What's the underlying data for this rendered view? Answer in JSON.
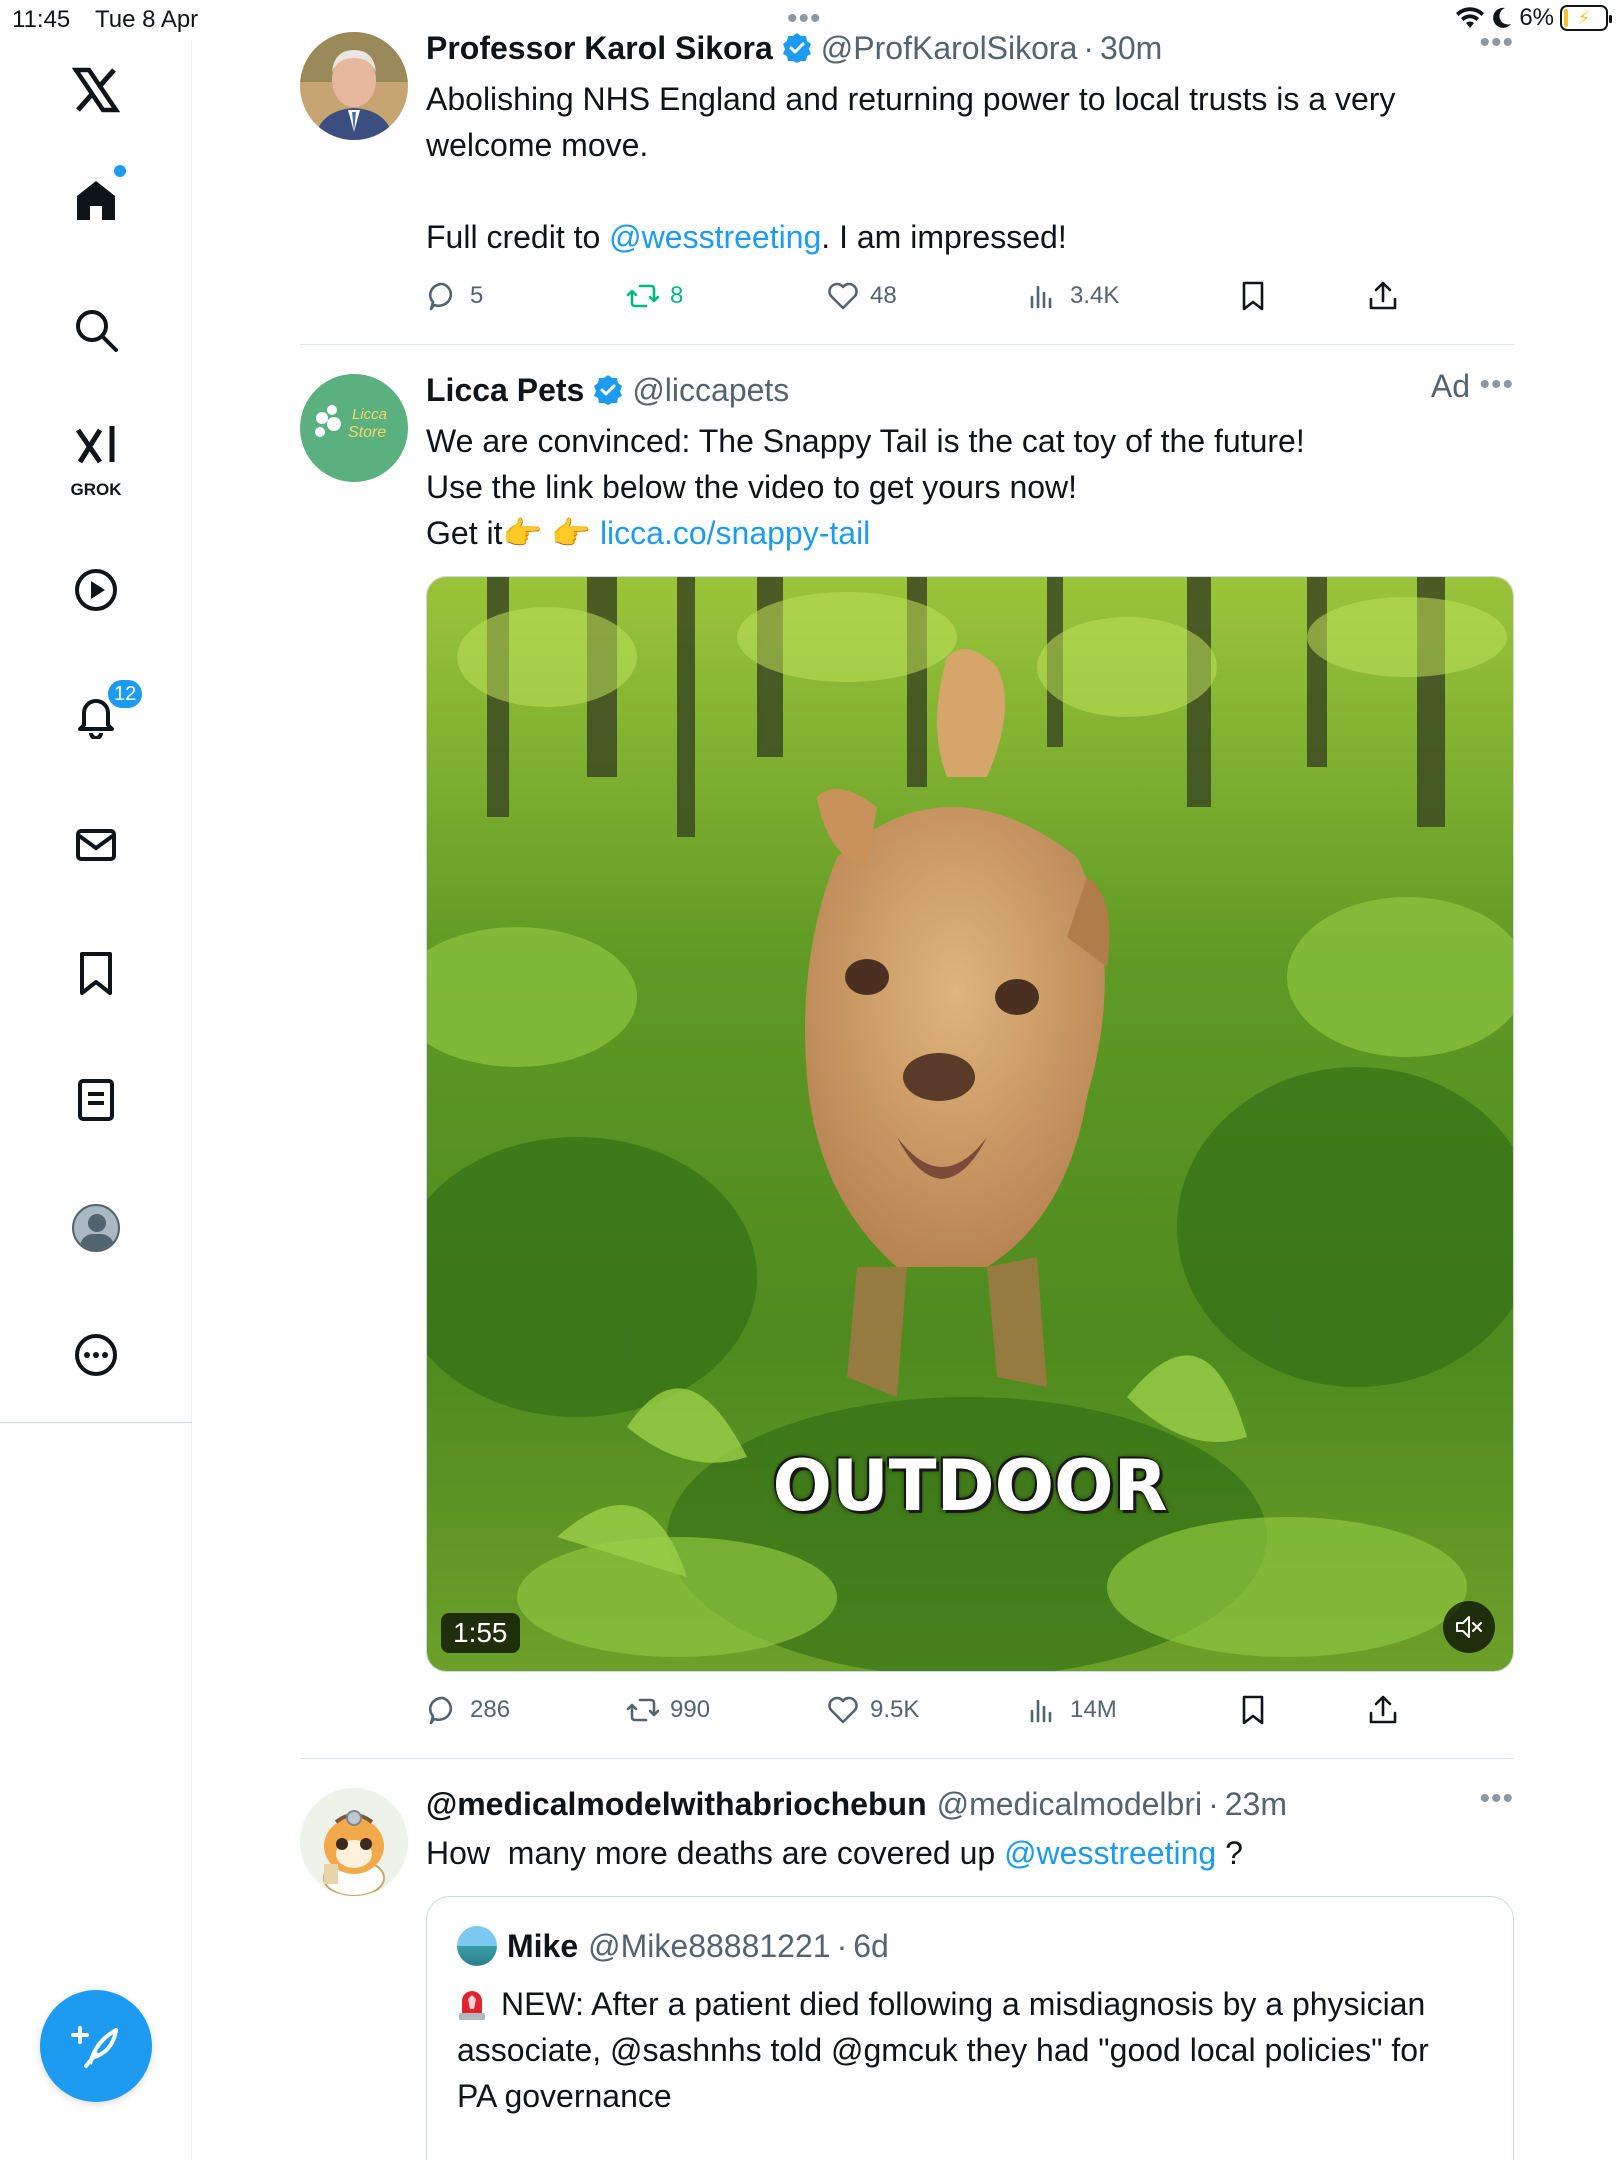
{
  "status_bar": {
    "time": "11:45",
    "date": "Tue 8 Apr",
    "battery": "6%"
  },
  "sidebar": {
    "grok_label": "GROK",
    "notifications_count": "12"
  },
  "tweets": [
    {
      "name": "Professor Karol Sikora",
      "handle": "@ProfKarolSikora",
      "time": "30m",
      "text_line1": "Abolishing NHS England and returning power to local trusts is a very welcome move.",
      "text_prefix": "Full credit to ",
      "mention": "@wesstreeting",
      "text_suffix": ". I am impressed!",
      "stats": {
        "replies": "5",
        "reposts": "8",
        "likes": "48",
        "views": "3.4K"
      }
    },
    {
      "name": "Licca Pets",
      "handle": "@liccapets",
      "ad_label": "Ad",
      "avatar_text_1": "Licca",
      "avatar_text_2": "Store",
      "text_line1": "We are convinced: The Snappy Tail is the cat toy of the future!",
      "text_line2": "Use the link below the video to get yours now!",
      "text_line3_prefix": "Get it",
      "text_line3_emoji": "👉 👉",
      "link": "licca.co/snappy-tail",
      "media": {
        "caption": "OUTDOOR",
        "duration": "1:55"
      },
      "stats": {
        "replies": "286",
        "reposts": "990",
        "likes": "9.5K",
        "views": "14M"
      }
    },
    {
      "name": "@medicalmodelwithabriochebun",
      "handle": "@medicalmodelbri",
      "time": "23m",
      "text_prefix": "How  many more deaths are covered up ",
      "mention": "@wesstreeting",
      "text_suffix": " ?",
      "quote": {
        "name": "Mike",
        "handle": "@Mike88881221",
        "time": "6d",
        "text": "NEW: After a patient died following a misdiagnosis by a physician associate, @sashnhs told @gmcuk they had \"good local policies\" for PA governance"
      }
    }
  ],
  "colors": {
    "accent": "#1d9bf0",
    "repost_green": "#00ba7c",
    "secondary_text": "#536471"
  }
}
